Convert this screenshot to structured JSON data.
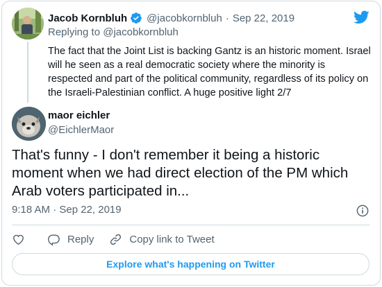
{
  "original_tweet": {
    "author_name": "Jacob Kornbluh",
    "handle": "@jacobkornbluh",
    "separator": "·",
    "date": "Sep 22, 2019",
    "replying_prefix": "Replying to",
    "replying_to": "@jacobkornbluh",
    "text": "The fact that the Joint List is backing Gantz is an historic moment. Israel will he seen as a real democratic society where the minority is respected and part of the political community, regardless of its policy on the Israeli-Palestinian conflict. A huge positive light  2/7"
  },
  "reply_tweet": {
    "author_name": "maor eichler",
    "handle": "@EichlerMaor",
    "text": "That's funny - I don't remember it being a historic moment when we had direct election of the PM which Arab voters participated in...",
    "timestamp": "9:18 AM · Sep 22, 2019"
  },
  "actions": {
    "reply_label": "Reply",
    "copy_link_label": "Copy link to Tweet"
  },
  "explore_button_label": "Explore what's happening on Twitter",
  "colors": {
    "brand_blue": "#1d9bf0",
    "text_primary": "#0f1419",
    "text_secondary": "#536471",
    "border": "#cfd9de"
  },
  "icons": [
    "twitter-bird-icon",
    "verified-badge-icon",
    "info-icon",
    "heart-icon",
    "reply-icon",
    "link-icon"
  ]
}
